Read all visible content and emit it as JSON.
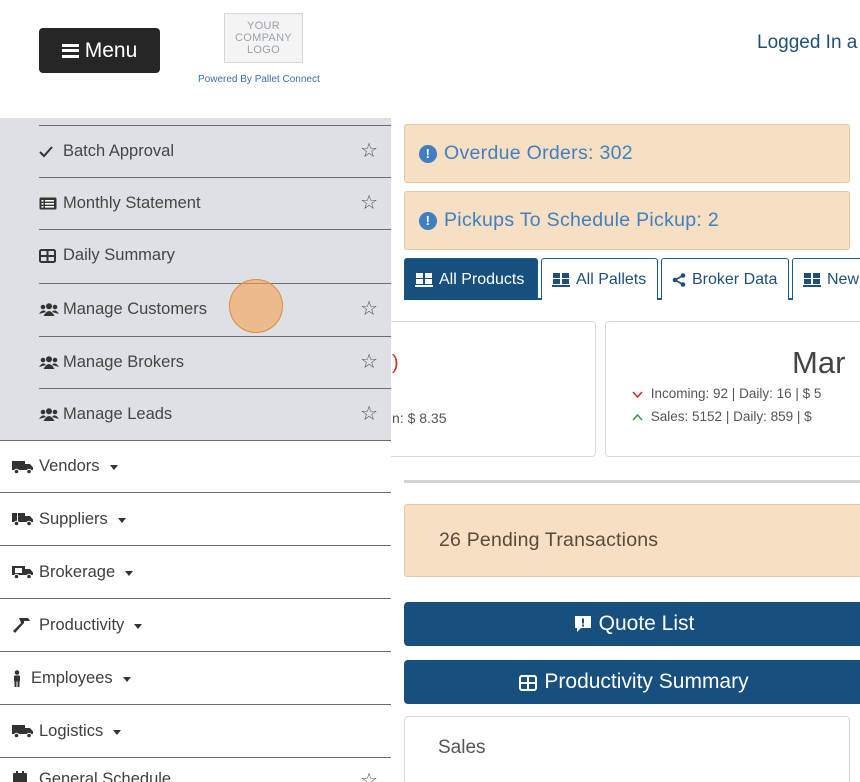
{
  "header": {
    "menu_label": "Menu",
    "logo_lines": [
      "YOUR",
      "COMPANY",
      "LOGO"
    ],
    "powered_by": "Powered By Pallet Connect",
    "logged_in": "Logged In a"
  },
  "sidebar": {
    "submenu_items": [
      {
        "label": "Batch Approval",
        "icon": "check-icon",
        "starred": false
      },
      {
        "label": "Monthly Statement",
        "icon": "list-alt-icon",
        "starred": false
      },
      {
        "label": "Daily Summary",
        "icon": "table-icon",
        "starred": null
      },
      {
        "label": "Manage Customers",
        "icon": "users-icon",
        "starred": false
      },
      {
        "label": "Manage Brokers",
        "icon": "users-icon",
        "starred": false
      },
      {
        "label": "Manage Leads",
        "icon": "users-icon",
        "starred": false
      }
    ],
    "main_items": [
      {
        "label": "Vendors",
        "icon": "truck-icon"
      },
      {
        "label": "Suppliers",
        "icon": "truck-icon"
      },
      {
        "label": "Brokerage",
        "icon": "truck-icon"
      },
      {
        "label": "Productivity",
        "icon": "hammer-icon"
      },
      {
        "label": "Employees",
        "icon": "person-icon"
      },
      {
        "label": "Logistics",
        "icon": "truck-icon"
      },
      {
        "label": "General Schedule",
        "icon": "calendar-icon"
      }
    ]
  },
  "main": {
    "alerts": [
      {
        "label": "Overdue Orders",
        "value": "302"
      },
      {
        "label": "Pickups To Schedule Pickup",
        "value": "2"
      }
    ],
    "tabs": [
      {
        "label": "All Products",
        "active": true
      },
      {
        "label": "All Pallets",
        "active": false
      },
      {
        "label": "Broker Data",
        "active": false
      },
      {
        "label": "New",
        "active": false
      }
    ],
    "card_left": {
      "partial_text": "n: $ 8.35"
    },
    "card_right": {
      "month": "Mar",
      "incoming": "Incoming: 92 | Daily: 16 | $ 5",
      "sales": "Sales: 5152 | Daily: 859 | $"
    },
    "pending": "26 Pending Transactions",
    "buttons": {
      "quote_list": "Quote List",
      "productivity_summary": "Productivity Summary"
    },
    "sales_panel_title": "Sales"
  },
  "colors": {
    "primary": "#17507f",
    "alert_bg": "#f6dfc3",
    "alert_text": "#3f7fc2",
    "submenu_bg": "#dde1e6"
  }
}
